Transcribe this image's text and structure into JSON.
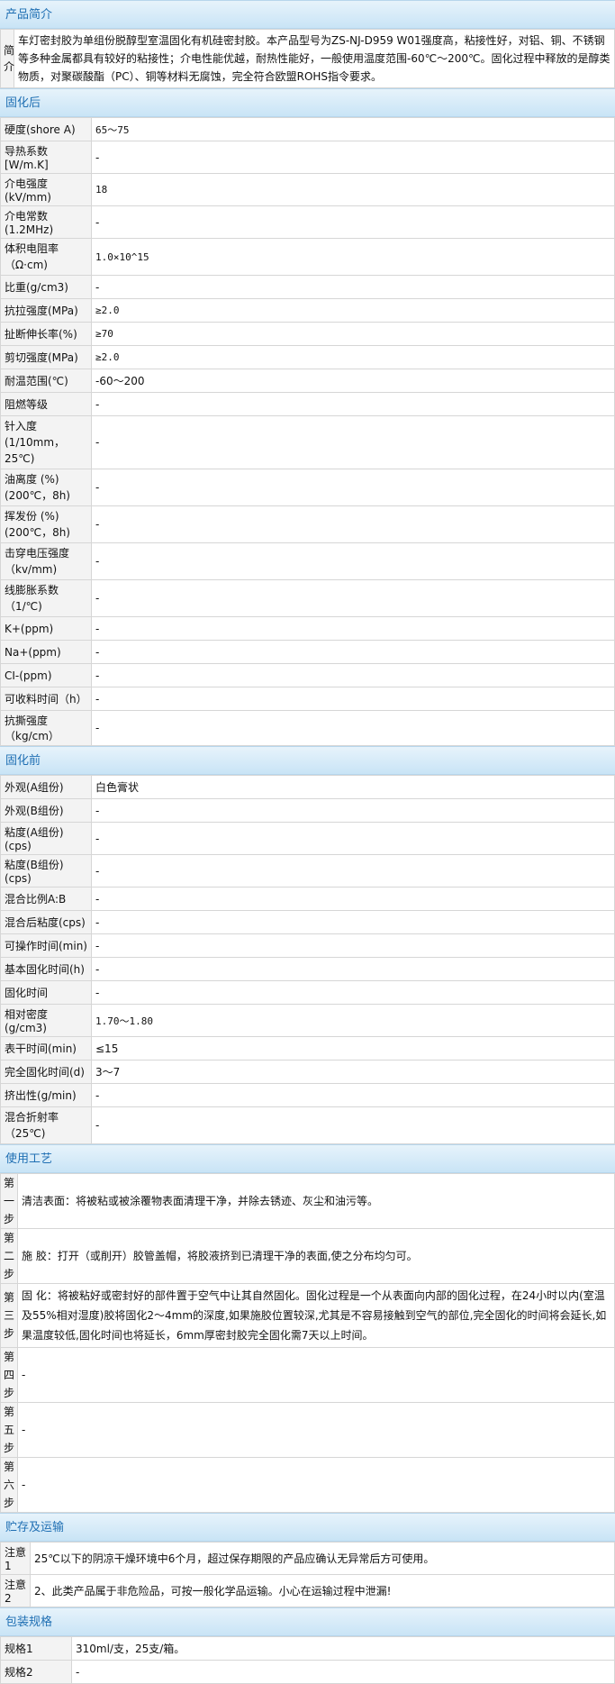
{
  "sections": {
    "intro": "产品简介",
    "after": "固化后",
    "before": "固化前",
    "process": "使用工艺",
    "storage": "贮存及运输",
    "package": "包装规格"
  },
  "intro": {
    "label": "简介",
    "text": "车灯密封胶为单组份脱醇型室温固化有机硅密封胶。本产品型号为ZS-NJ-D959 W01强度高，粘接性好，对铝、铜、不锈钢等多种金属都具有较好的粘接性；介电性能优越，耐热性能好，一般使用温度范围-60℃～200℃。固化过程中释放的是醇类物质，对聚碳酸酯（PC）、铜等材料无腐蚀，完全符合欧盟ROHS指令要求。"
  },
  "after": [
    {
      "k": "硬度(shore A)",
      "v": "65～75"
    },
    {
      "k": "导热系数 [W/m.K]",
      "v": "-"
    },
    {
      "k": "介电强度(kV/mm)",
      "v": "18"
    },
    {
      "k": "介电常数(1.2MHz)",
      "v": "-"
    },
    {
      "k": "体积电阻率（Ω·cm)",
      "v": "1.0×10^15"
    },
    {
      "k": "比重(g/cm3)",
      "v": "-"
    },
    {
      "k": "抗拉强度(MPa)",
      "v": "≥2.0"
    },
    {
      "k": "扯断伸长率(%)",
      "v": "≥70"
    },
    {
      "k": "剪切强度(MPa)",
      "v": "≥2.0"
    },
    {
      "k": "耐温范围(℃)",
      "v": "-60～200"
    },
    {
      "k": "阻燃等级",
      "v": "-"
    },
    {
      "k": "针入度 (1/10mm，25℃)",
      "v": "-"
    },
    {
      "k": "油离度 (%)(200℃，8h)",
      "v": "-"
    },
    {
      "k": "挥发份 (%)(200℃，8h)",
      "v": "-"
    },
    {
      "k": "击穿电压强度（kv/mm)",
      "v": "-"
    },
    {
      "k": "线膨胀系数（1/℃)",
      "v": "-"
    },
    {
      "k": "K+(ppm)",
      "v": "-"
    },
    {
      "k": "Na+(ppm)",
      "v": "-"
    },
    {
      "k": "CI-(ppm)",
      "v": "-"
    },
    {
      "k": "可收料时间（h）",
      "v": "-"
    },
    {
      "k": "抗撕强度（kg/cm）",
      "v": "-"
    }
  ],
  "before": [
    {
      "k": "外观(A组份)",
      "v": "白色膏状"
    },
    {
      "k": "外观(B组份)",
      "v": "-"
    },
    {
      "k": "粘度(A组份)(cps)",
      "v": "-"
    },
    {
      "k": "粘度(B组份)(cps)",
      "v": "-"
    },
    {
      "k": "混合比例A:B",
      "v": "-"
    },
    {
      "k": "混合后粘度(cps)",
      "v": "-"
    },
    {
      "k": "可操作时间(min)",
      "v": "-"
    },
    {
      "k": "基本固化时间(h)",
      "v": "-"
    },
    {
      "k": "固化时间",
      "v": "-"
    },
    {
      "k": "相对密度(g/cm3)",
      "v": "1.70～1.80"
    },
    {
      "k": "表干时间(min)",
      "v": "≤15"
    },
    {
      "k": "完全固化时间(d)",
      "v": "3～7"
    },
    {
      "k": "挤出性(g/min)",
      "v": "-"
    },
    {
      "k": "混合折射率（25℃)",
      "v": "-"
    }
  ],
  "steps": [
    {
      "k": "第一步",
      "v": "清洁表面：将被粘或被涂覆物表面清理干净，并除去锈迹、灰尘和油污等。"
    },
    {
      "k": "第二步",
      "v": "施 胶：打开（或削开）胶管盖帽，将胶液挤到已清理干净的表面,使之分布均匀可。"
    },
    {
      "k": "第三步",
      "v": "固 化：将被粘好或密封好的部件置于空气中让其自然固化。固化过程是一个从表面向内部的固化过程，在24小时以内(室温及55%相对湿度)胶将固化2～4mm的深度,如果施胶位置较深,尤其是不容易接触到空气的部位,完全固化的时间将会延长,如果温度较低,固化时间也将延长，6mm厚密封胶完全固化需7天以上时间。"
    },
    {
      "k": "第四步",
      "v": "-"
    },
    {
      "k": "第五步",
      "v": "-"
    },
    {
      "k": "第六步",
      "v": "-"
    }
  ],
  "storage": [
    {
      "k": "注意1",
      "v": "25℃以下的阴凉干燥环境中6个月，超过保存期限的产品应确认无异常后方可使用。"
    },
    {
      "k": "注意2",
      "v": "2、此类产品属于非危险品，可按一般化学品运输。小心在运输过程中泄漏!"
    }
  ],
  "package": [
    {
      "k": "规格1",
      "v": "310ml/支，25支/箱。"
    },
    {
      "k": "规格2",
      "v": "-"
    }
  ]
}
